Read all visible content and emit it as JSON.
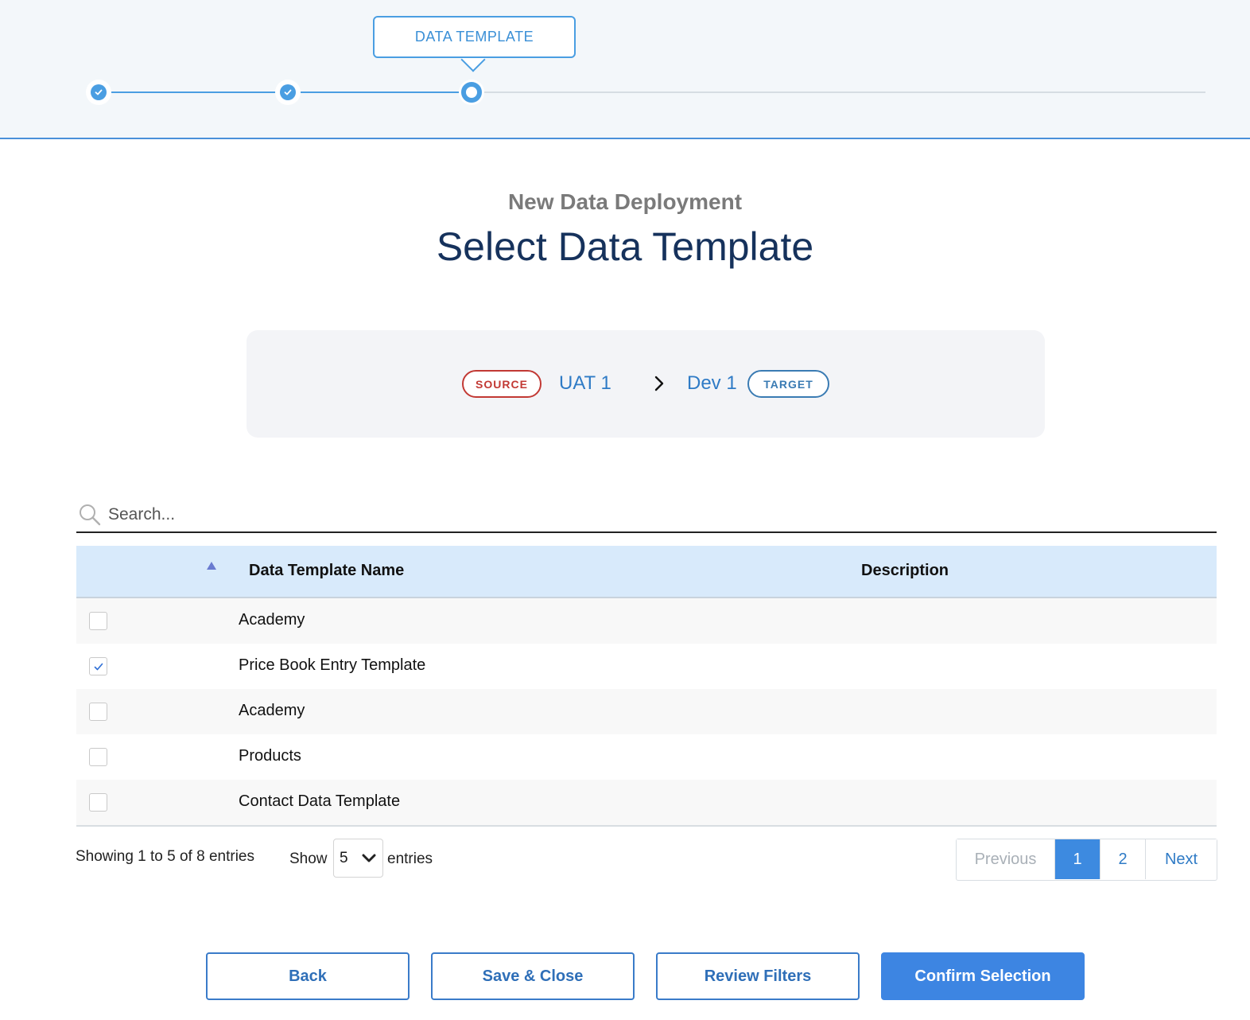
{
  "progress": {
    "current_step_label": "DATA TEMPLATE"
  },
  "header": {
    "subtitle": "New Data Deployment",
    "title": "Select Data Template"
  },
  "environments": {
    "source_badge": "SOURCE",
    "source_name": "UAT 1",
    "target_name": "Dev 1",
    "target_badge": "TARGET"
  },
  "search": {
    "placeholder": "Search..."
  },
  "table": {
    "columns": [
      "Data Template Name",
      "Description"
    ],
    "rows": [
      {
        "name": "Academy",
        "description": "",
        "checked": false
      },
      {
        "name": "Price Book Entry Template",
        "description": "",
        "checked": true
      },
      {
        "name": "Academy",
        "description": "",
        "checked": false
      },
      {
        "name": "Products",
        "description": "",
        "checked": false
      },
      {
        "name": "Contact Data Template",
        "description": "",
        "checked": false
      }
    ]
  },
  "pagination": {
    "showing_text": "Showing 1 to 5 of 8 entries",
    "show_label": "Show",
    "page_size": "5",
    "entries_label": "entries",
    "previous": "Previous",
    "pages": [
      "1",
      "2"
    ],
    "current_page": "1",
    "next": "Next"
  },
  "actions": {
    "back": "Back",
    "save_close": "Save & Close",
    "review_filters": "Review Filters",
    "confirm": "Confirm Selection"
  },
  "colors": {
    "accent": "#4a9ee2",
    "primary_button": "#3d85e2",
    "source_red": "#c23934",
    "target_blue": "#3a7bb3",
    "header_row": "#d8eafb"
  }
}
